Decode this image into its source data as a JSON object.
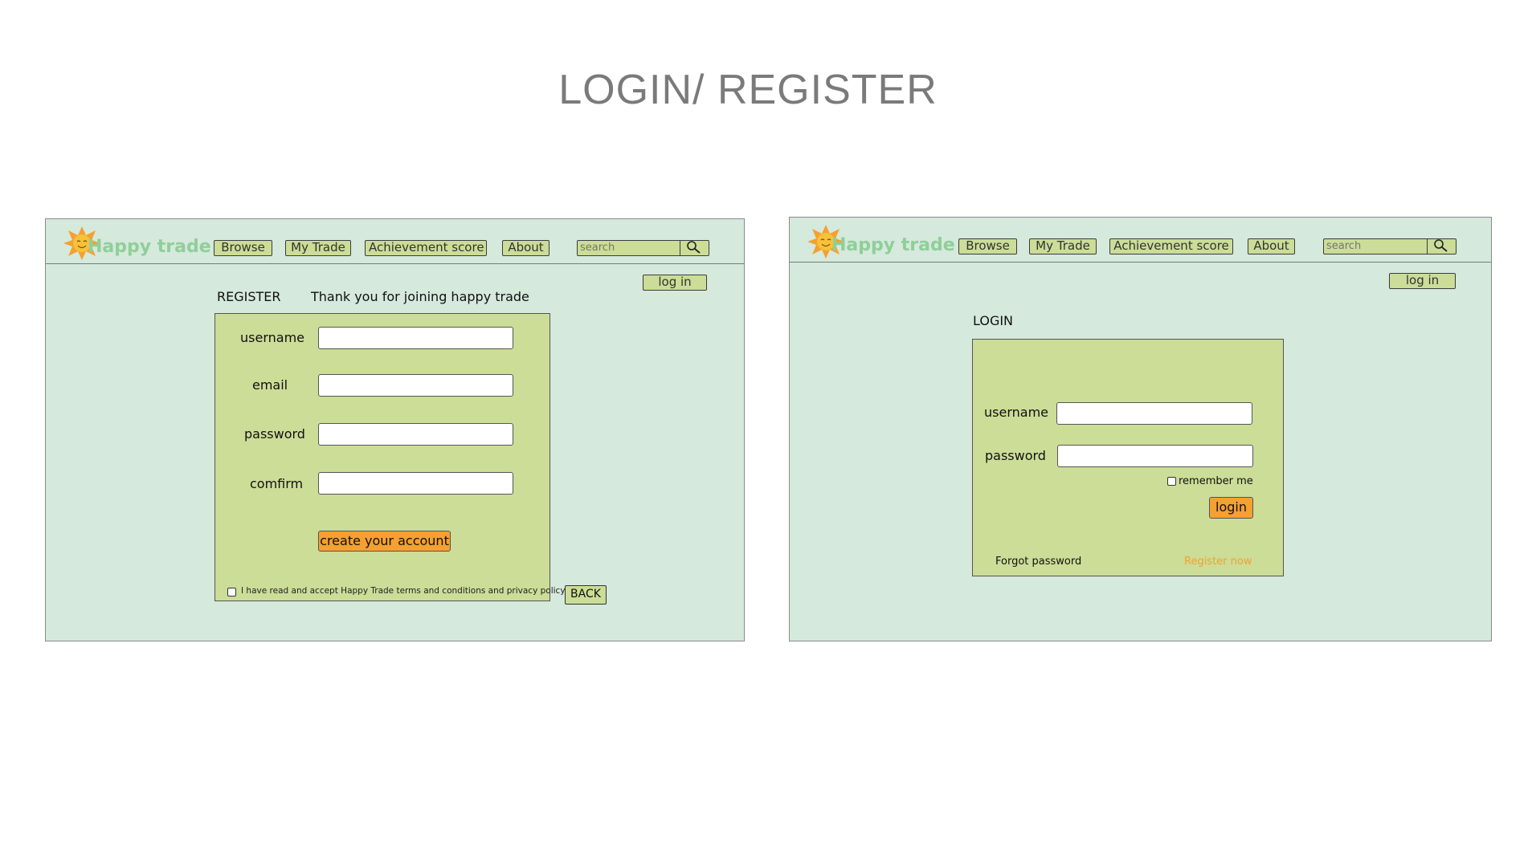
{
  "page": {
    "title": "LOGIN/ REGISTER"
  },
  "header": {
    "logo_text": "Happy trade",
    "nav": [
      "Browse",
      "My Trade",
      "Achievement score",
      "About"
    ],
    "search_placeholder": "search",
    "login_button": "log in"
  },
  "register": {
    "heading": "REGISTER",
    "subheading": "Thank you for joining happy trade",
    "fields": {
      "username": "username",
      "email": "email",
      "password": "password",
      "confirm": "comfirm"
    },
    "submit": "create your account",
    "terms": "I have read and accept Happy Trade terms and conditions and privacy policy.",
    "back": "BACK"
  },
  "login": {
    "heading": "LOGIN",
    "fields": {
      "username": "username",
      "password": "password"
    },
    "remember": "remember me",
    "submit": "login",
    "forgot": "Forgot password",
    "register_link": "Register now"
  },
  "colors": {
    "panel_bg": "#d5e9dc",
    "form_bg": "#cbdd97",
    "accent_orange": "#f5a030",
    "logo_green": "#8fcf98",
    "register_link": "#f5a030"
  },
  "icons": {
    "logo": "sun-icon",
    "search": "magnifier-icon"
  }
}
